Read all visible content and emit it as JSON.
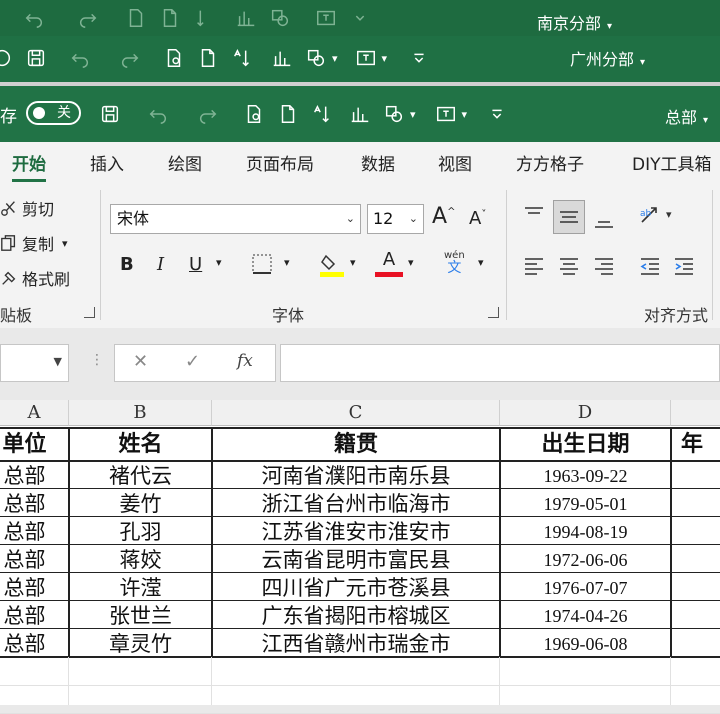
{
  "windows": [
    {
      "branch": "南京分部"
    },
    {
      "branch": "广州分部"
    },
    {
      "branch": "总部"
    }
  ],
  "autosave": {
    "label": "存",
    "toggle": "关"
  },
  "tabs": [
    "开始",
    "插入",
    "绘图",
    "页面布局",
    "数据",
    "视图",
    "方方格子",
    "DIY工具箱"
  ],
  "ribbon": {
    "clipboard": {
      "cut": "剪切",
      "copy": "复制",
      "format_painter": "格式刷",
      "group_label": "贴板"
    },
    "font": {
      "name": "宋体",
      "size": "12",
      "group_label": "字体",
      "bold": "B",
      "italic": "I",
      "underline": "U",
      "font_color": "A",
      "phonetic_top": "wén",
      "phonetic_bottom": "文"
    },
    "alignment": {
      "group_label": "对齐方式"
    }
  },
  "formula_bar": {
    "fx": "fx",
    "value": ""
  },
  "columns": [
    "A",
    "B",
    "C",
    "D"
  ],
  "table": {
    "headers": [
      "单位",
      "姓名",
      "籍贯",
      "出生日期",
      "年"
    ],
    "rows": [
      [
        "总部",
        "褚代云",
        "河南省濮阳市南乐县",
        "1963-09-22"
      ],
      [
        "总部",
        "姜竹",
        "浙江省台州市临海市",
        "1979-05-01"
      ],
      [
        "总部",
        "孔羽",
        "江苏省淮安市淮安市",
        "1994-08-19"
      ],
      [
        "总部",
        "蒋姣",
        "云南省昆明市富民县",
        "1972-06-06"
      ],
      [
        "总部",
        "许滢",
        "四川省广元市苍溪县",
        "1976-07-07"
      ],
      [
        "总部",
        "张世兰",
        "广东省揭阳市榕城区",
        "1974-04-26"
      ],
      [
        "总部",
        "章灵竹",
        "江西省赣州市瑞金市",
        "1969-06-08"
      ]
    ]
  },
  "colors": {
    "excel_green": "#217346",
    "ribbon_bg": "#f3f3f3"
  }
}
